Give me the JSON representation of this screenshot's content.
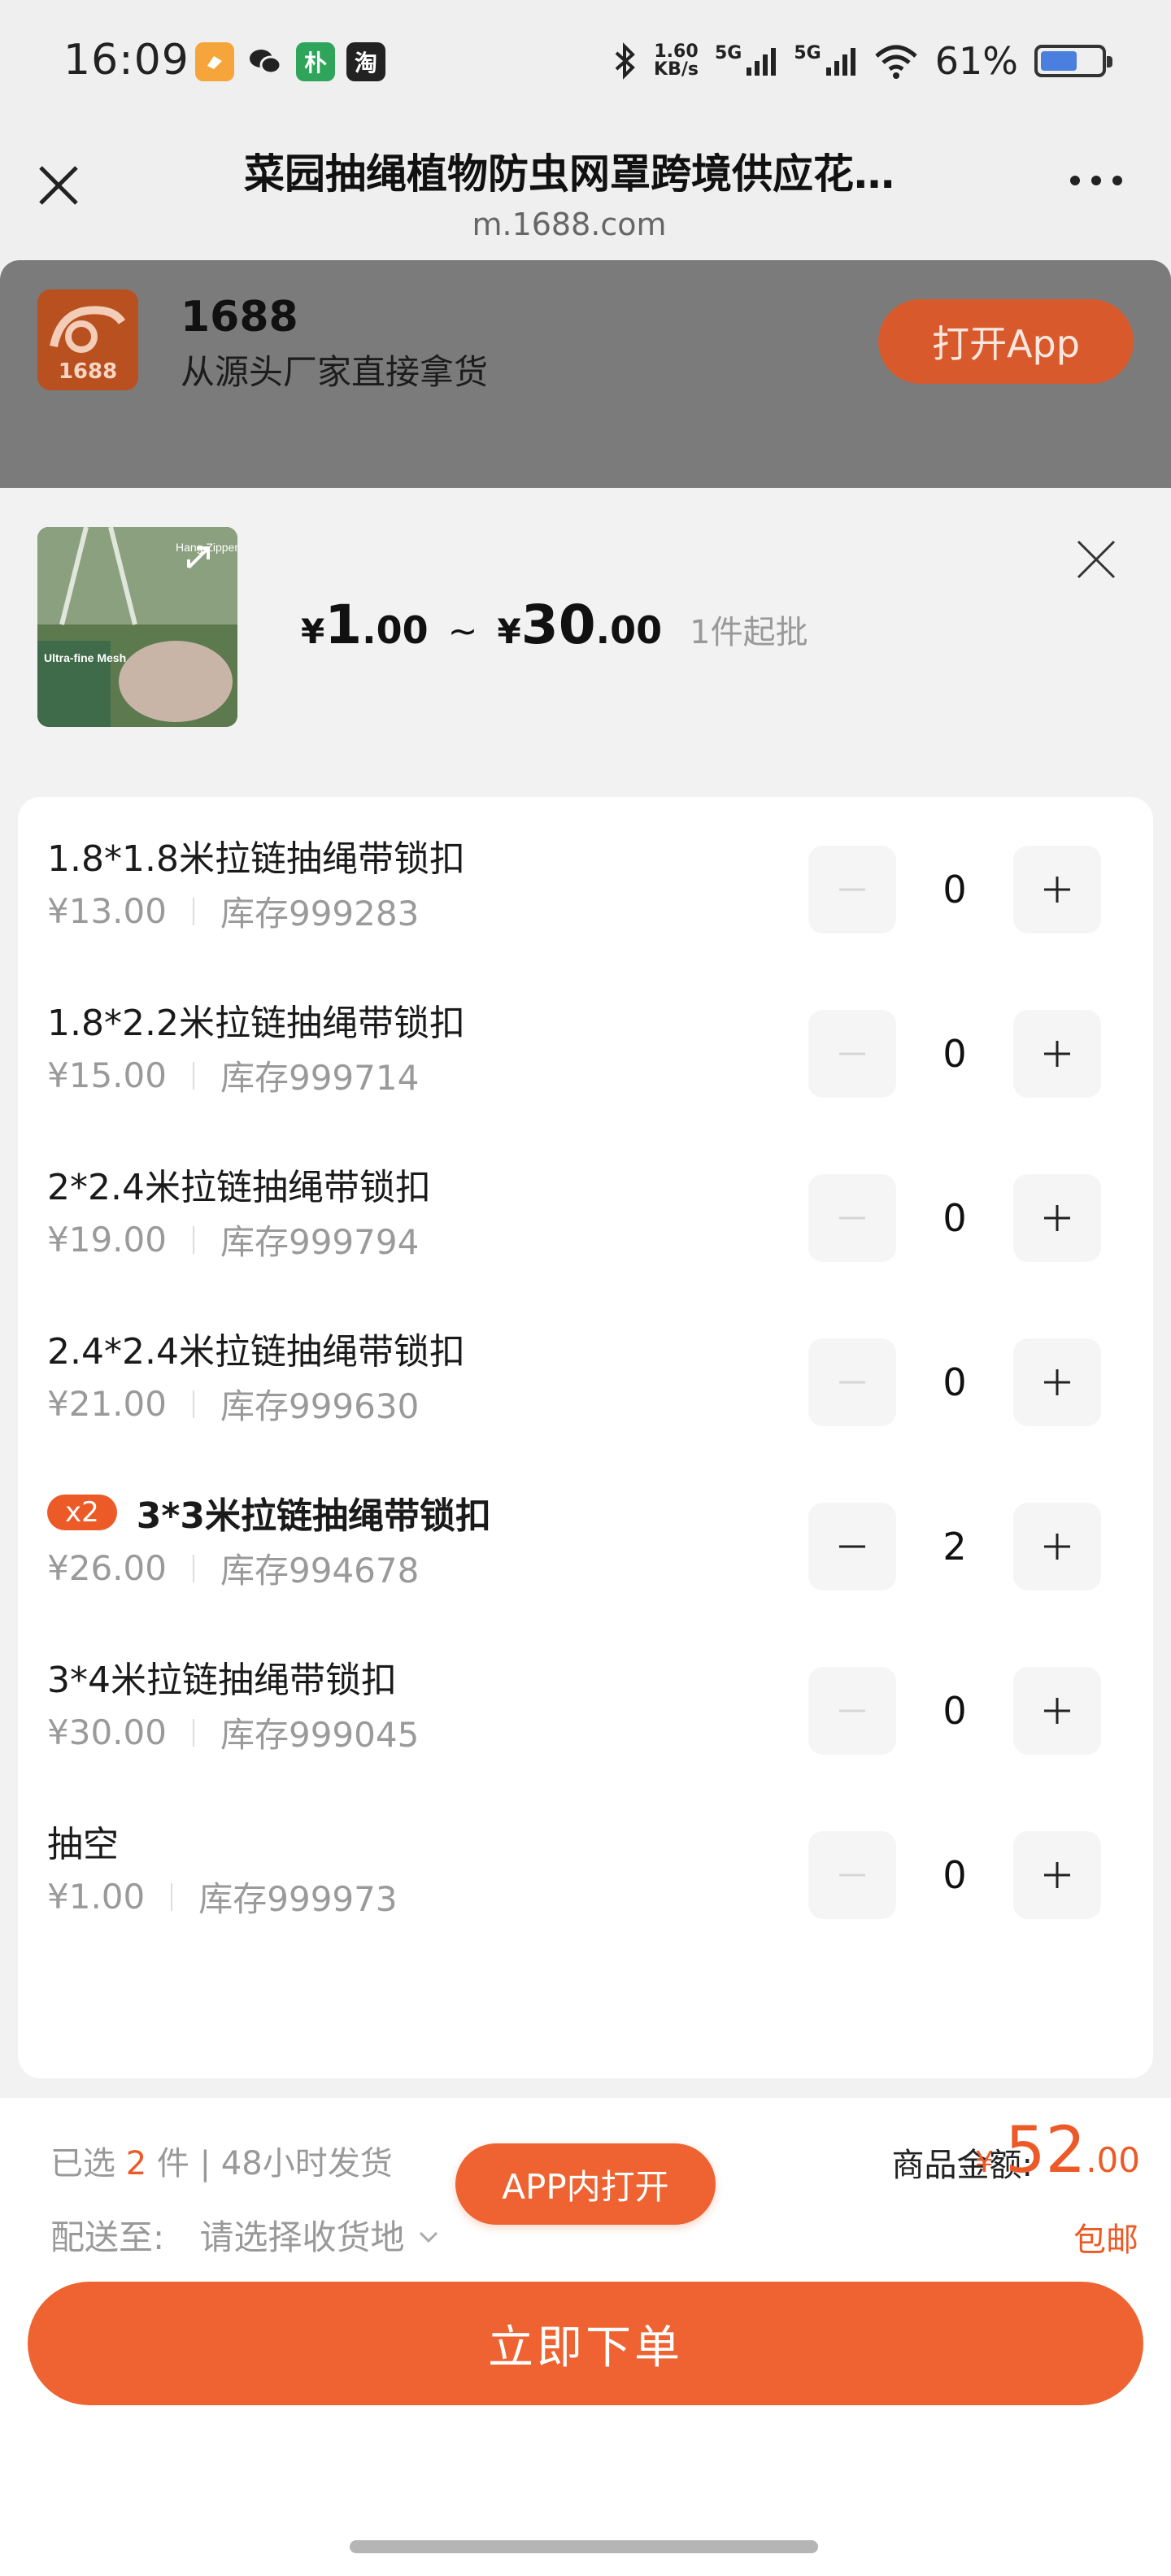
{
  "status_bar": {
    "time": "16:09",
    "net_speed_value": "1.60",
    "net_speed_unit": "KB/s",
    "sig1": "5G",
    "sig2": "5G",
    "battery": "61%",
    "battery_level": 0.61,
    "apps": [
      "taobao-style-icon",
      "wechat-icon",
      "pu-icon",
      "tao-icon"
    ],
    "app_labels": [
      "",
      "",
      "朴",
      "淘"
    ]
  },
  "browser": {
    "title": "菜园抽绳植物防虫网罩跨境供应花…",
    "url": "m.1688.com"
  },
  "app_banner": {
    "logo_text": "1688",
    "name": "1688",
    "slogan": "从源头厂家直接拿货",
    "open_button": "打开App"
  },
  "product": {
    "price_sym": "¥",
    "price_min_int": "1",
    "price_min_dec": ".00",
    "tilde": "~",
    "price_max_int": "30",
    "price_max_dec": ".00",
    "moq": "1件起批",
    "thumb_texts": [
      "Hang Zipper",
      "Ultra-fine Mesh"
    ]
  },
  "skus": [
    {
      "name": "1.8*1.8米拉链抽绳带锁扣",
      "price": "¥13.00",
      "stock": "库存999283",
      "qty": "0",
      "badge": ""
    },
    {
      "name": "1.8*2.2米拉链抽绳带锁扣",
      "price": "¥15.00",
      "stock": "库存999714",
      "qty": "0",
      "badge": ""
    },
    {
      "name": "2*2.4米拉链抽绳带锁扣",
      "price": "¥19.00",
      "stock": "库存999794",
      "qty": "0",
      "badge": ""
    },
    {
      "name": "2.4*2.4米拉链抽绳带锁扣",
      "price": "¥21.00",
      "stock": "库存999630",
      "qty": "0",
      "badge": ""
    },
    {
      "name": "3*3米拉链抽绳带锁扣",
      "price": "¥26.00",
      "stock": "库存994678",
      "qty": "2",
      "badge": "x2"
    },
    {
      "name": "3*4米拉链抽绳带锁扣",
      "price": "¥30.00",
      "stock": "库存999045",
      "qty": "0",
      "badge": ""
    },
    {
      "name": "抽空",
      "price": "¥1.00",
      "stock": "库存999973",
      "qty": "0",
      "badge": ""
    }
  ],
  "bottom": {
    "selected_prefix": "已选",
    "selected_count": "2",
    "selected_suffix": "件 | 48小时发货",
    "ship_label": "配送至:",
    "ship_value": "请选择收货地",
    "amount_label": "商品金额:",
    "amount_sym": "¥",
    "amount_int": "52",
    "amount_dec": ".00",
    "free_ship": "包邮",
    "open_in_app": "APP内打开",
    "order_button": "立即下单"
  },
  "colors": {
    "accent": "#ec5a28",
    "banner_overlay": "#7b7b7b"
  }
}
